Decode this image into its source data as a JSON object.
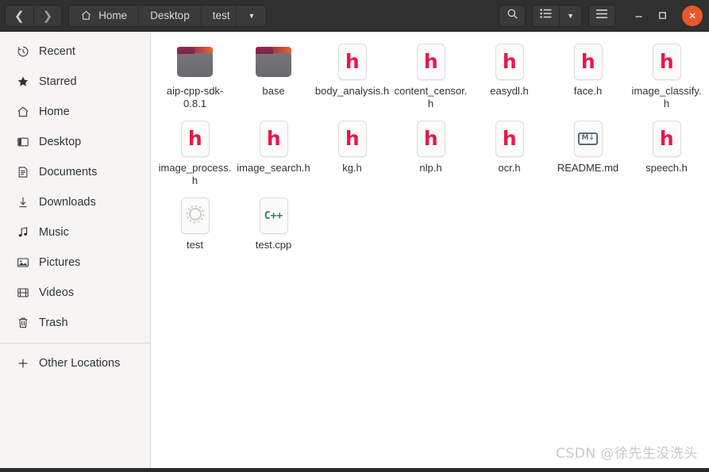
{
  "window": {
    "title": "test",
    "bg_dark": "#303030",
    "accent_close": "#e8572b"
  },
  "header": {
    "nav": {
      "back_icon": "❮",
      "forward_icon": "❯",
      "back_name": "back-button",
      "forward_name": "forward-button"
    },
    "breadcrumbs": [
      {
        "label": "Home",
        "icon": "home-icon"
      },
      {
        "label": "Desktop",
        "icon": ""
      },
      {
        "label": "test",
        "icon": ""
      }
    ],
    "caret": "▼",
    "search_label": "Search",
    "view_list_label": "List view",
    "view_dropdown_caret": "▼",
    "menu_label": "Menu",
    "minimize": "–",
    "maximize": "□",
    "close": "✕"
  },
  "sidebar": {
    "items": [
      {
        "label": "Recent",
        "icon": "clock-icon"
      },
      {
        "label": "Starred",
        "icon": "star-icon"
      },
      {
        "label": "Home",
        "icon": "home-icon"
      },
      {
        "label": "Desktop",
        "icon": "desktop-icon"
      },
      {
        "label": "Documents",
        "icon": "documents-icon"
      },
      {
        "label": "Downloads",
        "icon": "download-icon"
      },
      {
        "label": "Music",
        "icon": "music-icon"
      },
      {
        "label": "Pictures",
        "icon": "pictures-icon"
      },
      {
        "label": "Videos",
        "icon": "videos-icon"
      },
      {
        "label": "Trash",
        "icon": "trash-icon"
      }
    ],
    "other_locations": {
      "label": "Other Locations",
      "icon": "plus-icon"
    }
  },
  "files": [
    {
      "name": "aip-cpp-sdk-0.8.1",
      "type": "folder",
      "glyph": ""
    },
    {
      "name": "base",
      "type": "folder",
      "glyph": ""
    },
    {
      "name": "body_analysis.h",
      "type": "header",
      "glyph": "h"
    },
    {
      "name": "content_censor.h",
      "type": "header",
      "glyph": "h"
    },
    {
      "name": "easydl.h",
      "type": "header",
      "glyph": "h"
    },
    {
      "name": "face.h",
      "type": "header",
      "glyph": "h"
    },
    {
      "name": "image_classify.h",
      "type": "header",
      "glyph": "h"
    },
    {
      "name": "image_process.h",
      "type": "header",
      "glyph": "h"
    },
    {
      "name": "image_search.h",
      "type": "header",
      "glyph": "h"
    },
    {
      "name": "kg.h",
      "type": "header",
      "glyph": "h"
    },
    {
      "name": "nlp.h",
      "type": "header",
      "glyph": "h"
    },
    {
      "name": "ocr.h",
      "type": "header",
      "glyph": "h"
    },
    {
      "name": "README.md",
      "type": "markdown",
      "glyph": "M↓"
    },
    {
      "name": "speech.h",
      "type": "header",
      "glyph": "h"
    },
    {
      "name": "test",
      "type": "executable",
      "glyph": ""
    },
    {
      "name": "test.cpp",
      "type": "cpp",
      "glyph": "C++"
    }
  ],
  "watermark": {
    "text": "CSDN @徐先生没洗头"
  },
  "colors": {
    "header_bg": "#303030",
    "sidebar_bg": "#f6f5f4",
    "content_bg": "#ffffff",
    "h_glyph": "#e8174b",
    "cpp_glyph": "#2c7a74",
    "folder_grey": "#6f6f73",
    "folder_purple": "#8e2b4e",
    "folder_orange": "#e8642a"
  }
}
